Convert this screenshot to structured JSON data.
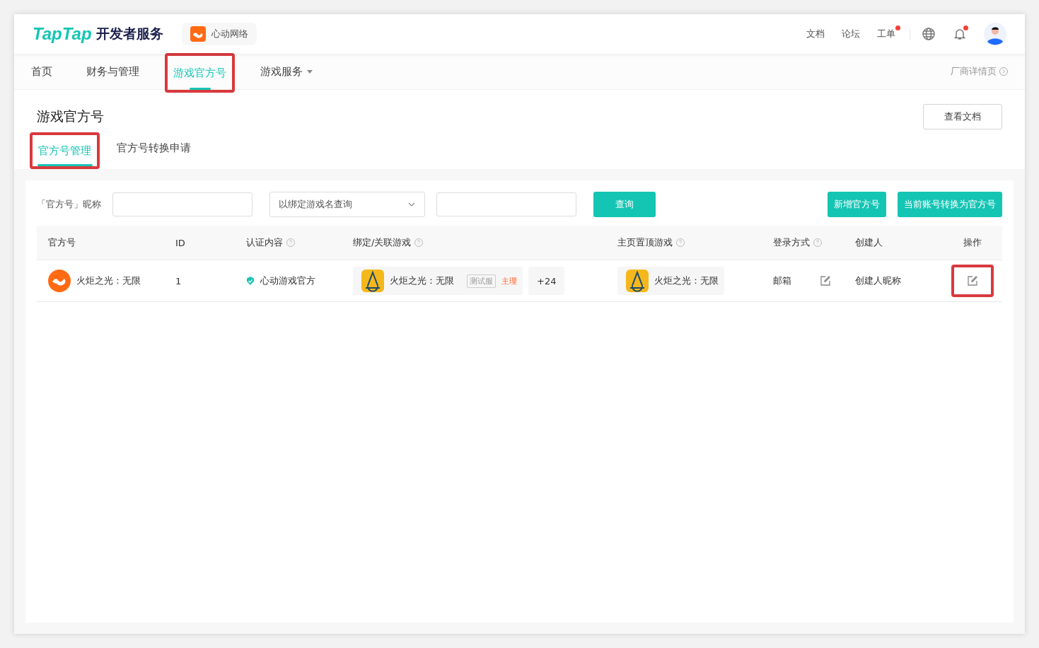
{
  "header": {
    "brand": "TapTap",
    "brand_suffix": "开发者服务",
    "org": "心动网络",
    "links": [
      {
        "label": "文档",
        "dot": false
      },
      {
        "label": "论坛",
        "dot": false
      },
      {
        "label": "工单",
        "dot": true
      }
    ],
    "bell_dot": true
  },
  "nav": {
    "items": [
      {
        "label": "首页",
        "selected": false,
        "highlighted": false,
        "dropdown": false
      },
      {
        "label": "财务与管理",
        "selected": false,
        "highlighted": false,
        "dropdown": false
      },
      {
        "label": "游戏官方号",
        "selected": true,
        "highlighted": true,
        "dropdown": false
      },
      {
        "label": "游戏服务",
        "selected": false,
        "highlighted": false,
        "dropdown": true
      }
    ],
    "right_link": "厂商详情页"
  },
  "page": {
    "title": "游戏官方号",
    "docs_button": "查看文档",
    "tabs": [
      {
        "label": "官方号管理",
        "selected": true,
        "highlighted": true
      },
      {
        "label": "官方号转换申请",
        "selected": false,
        "highlighted": false
      }
    ]
  },
  "filters": {
    "name_label": "「官方号」昵称",
    "select_value": "以绑定游戏名查询",
    "query_button": "查询",
    "actions": [
      "新增官方号",
      "当前账号转换为官方号"
    ]
  },
  "table": {
    "columns": [
      {
        "label": "官方号",
        "help": false
      },
      {
        "label": "ID",
        "help": false
      },
      {
        "label": "认证内容",
        "help": true
      },
      {
        "label": "绑定/关联游戏",
        "help": true
      },
      {
        "label": "主页置顶游戏",
        "help": true
      },
      {
        "label": "登录方式",
        "help": true
      },
      {
        "label": "创建人",
        "help": false
      },
      {
        "label": "操作",
        "help": false
      }
    ],
    "rows": [
      {
        "name": "火炬之光：无限",
        "id": "1",
        "certification": "心动游戏官方",
        "bound_game": "火炬之光：无限",
        "bound_tag": "测试服",
        "bound_role": "主理",
        "more": "+24",
        "pinned_game": "火炬之光：无限",
        "login": "邮箱",
        "creator": "创建人昵称",
        "action_highlighted": true
      }
    ]
  }
}
